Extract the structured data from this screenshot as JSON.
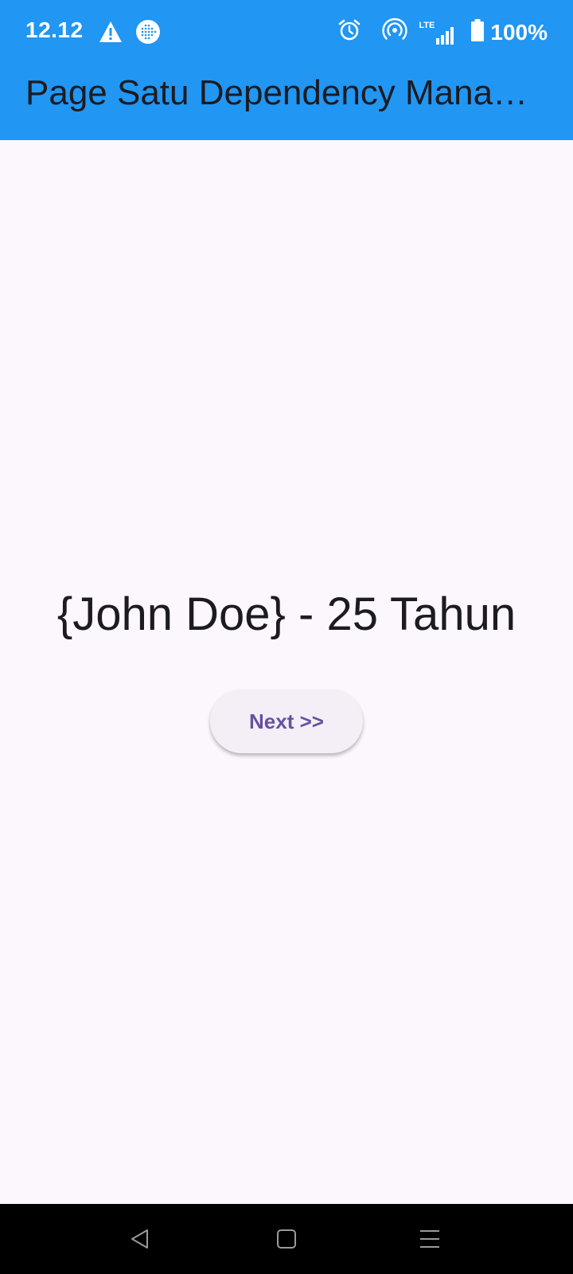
{
  "status_bar": {
    "time": "12.12",
    "battery": "100%",
    "network_label": "LTE",
    "icons": [
      "warning-icon",
      "browser-globe-icon",
      "alarm-icon",
      "hotspot-icon",
      "lte-signal-icon",
      "battery-icon"
    ]
  },
  "app_bar": {
    "title": "Page Satu  Dependency Management"
  },
  "main": {
    "person_text": "{John Doe} - 25 Tahun",
    "next_button_label": "Next >>"
  },
  "nav_bar": {
    "icons": [
      "back-icon",
      "home-icon",
      "recents-icon"
    ]
  },
  "colors": {
    "app_bar": "#2196F3",
    "background": "#FCF7FD",
    "button_text": "#6750A4",
    "button_bg": "#F4EFF6",
    "text": "#1D1B20"
  }
}
